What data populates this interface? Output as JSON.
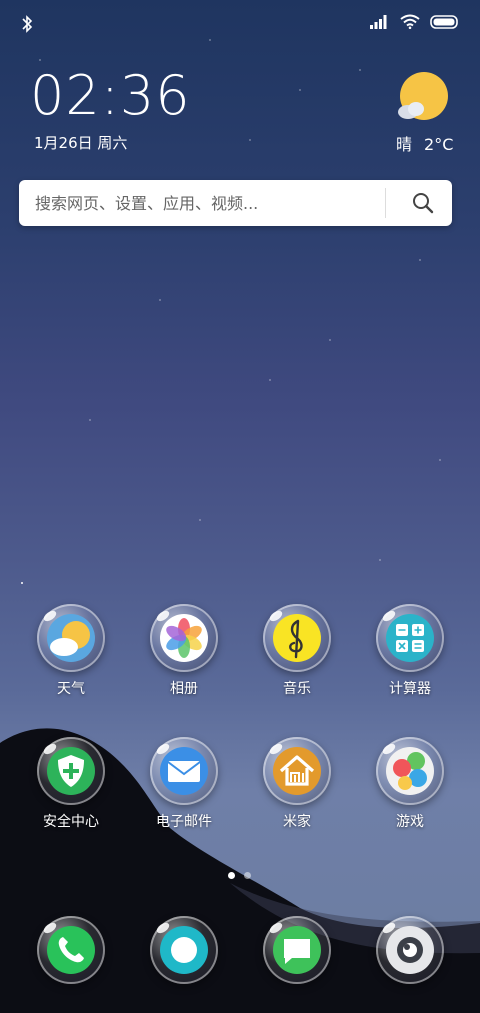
{
  "status_bar": {
    "icons": [
      "bluetooth-icon",
      "signal-icon",
      "wifi-icon",
      "battery-icon"
    ]
  },
  "lock": {
    "time": "02:36",
    "date": "1月26日 周六"
  },
  "weather": {
    "condition": "晴",
    "temperature": "2°C",
    "icon": "sunny-cloud-icon"
  },
  "search": {
    "placeholder": "搜索网页、设置、应用、视频..."
  },
  "apps": [
    {
      "label": "天气",
      "icon": "weather-icon"
    },
    {
      "label": "相册",
      "icon": "gallery-icon"
    },
    {
      "label": "音乐",
      "icon": "music-icon"
    },
    {
      "label": "计算器",
      "icon": "calculator-icon"
    },
    {
      "label": "安全中心",
      "icon": "security-icon"
    },
    {
      "label": "电子邮件",
      "icon": "email-icon"
    },
    {
      "label": "米家",
      "icon": "mijia-icon"
    },
    {
      "label": "游戏",
      "icon": "games-icon"
    }
  ],
  "page_indicator": {
    "pages": 2,
    "current": 1
  },
  "dock": [
    {
      "icon": "phone-icon"
    },
    {
      "icon": "browser-icon"
    },
    {
      "icon": "messages-icon"
    },
    {
      "icon": "camera-icon"
    }
  ]
}
